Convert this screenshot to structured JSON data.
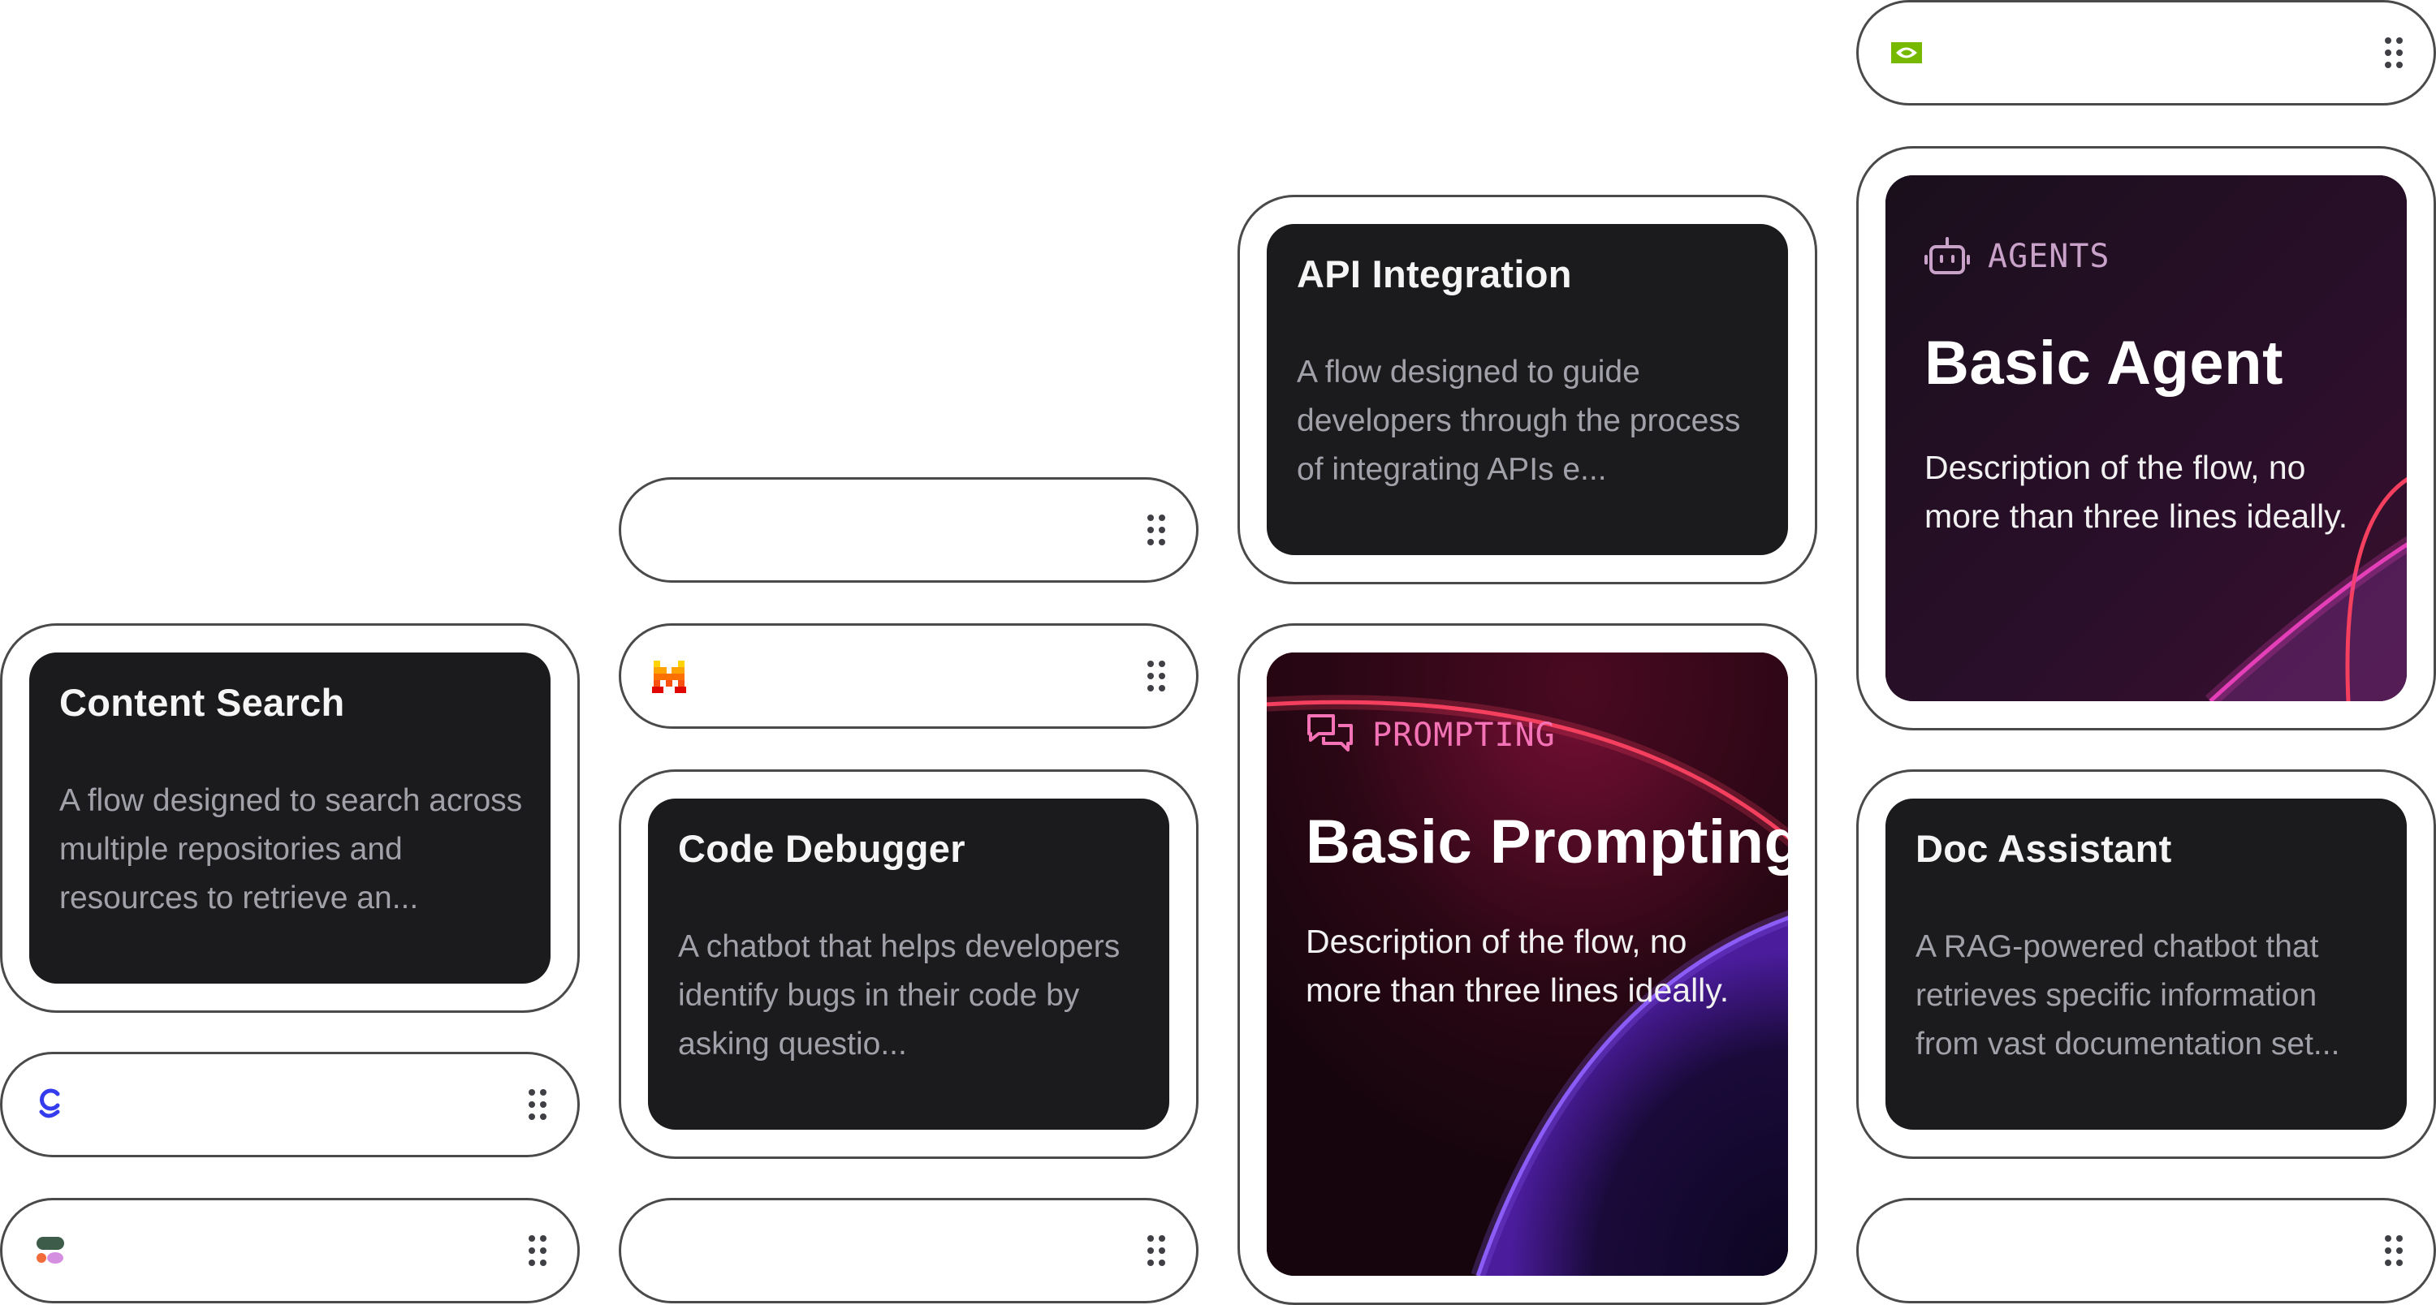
{
  "cards": {
    "content_search": {
      "title": "Content Search",
      "description": "A flow designed to search across multiple repositories and resources to retrieve an..."
    },
    "code_debugger": {
      "title": "Code Debugger",
      "description": "A chatbot that helps developers identify bugs in their code by asking questio..."
    },
    "api_integration": {
      "title": "API Integration",
      "description": "A flow designed to guide developers through the process of integrating APIs e..."
    },
    "doc_assistant": {
      "title": "Doc Assistant",
      "description": "A RAG-powered chatbot that retrieves specific information from vast documentation set..."
    },
    "basic_prompting": {
      "category": "PROMPTING",
      "title": "Basic Prompting",
      "description": "Description of the flow, no more than three lines ideally."
    },
    "basic_agent": {
      "category": "AGENTS",
      "title": "Basic Agent",
      "description": "Description of the flow, no more than three lines ideally."
    }
  },
  "pills": [
    {
      "icon": "glean-logo-icon"
    },
    {
      "icon": "notion-blob-logo-icon"
    },
    {
      "icon": "none"
    },
    {
      "icon": "mistral-logo-icon"
    },
    {
      "icon": "none"
    },
    {
      "icon": "nvidia-logo-icon"
    },
    {
      "icon": "none"
    }
  ],
  "colors": {
    "card_bg": "#1b1b1d",
    "prompting_accent": "#f472b6",
    "agents_accent": "#c9a2c9",
    "border": "#4a4a4a",
    "nvidia_green": "#76b900",
    "glean_blue": "#343ced"
  }
}
